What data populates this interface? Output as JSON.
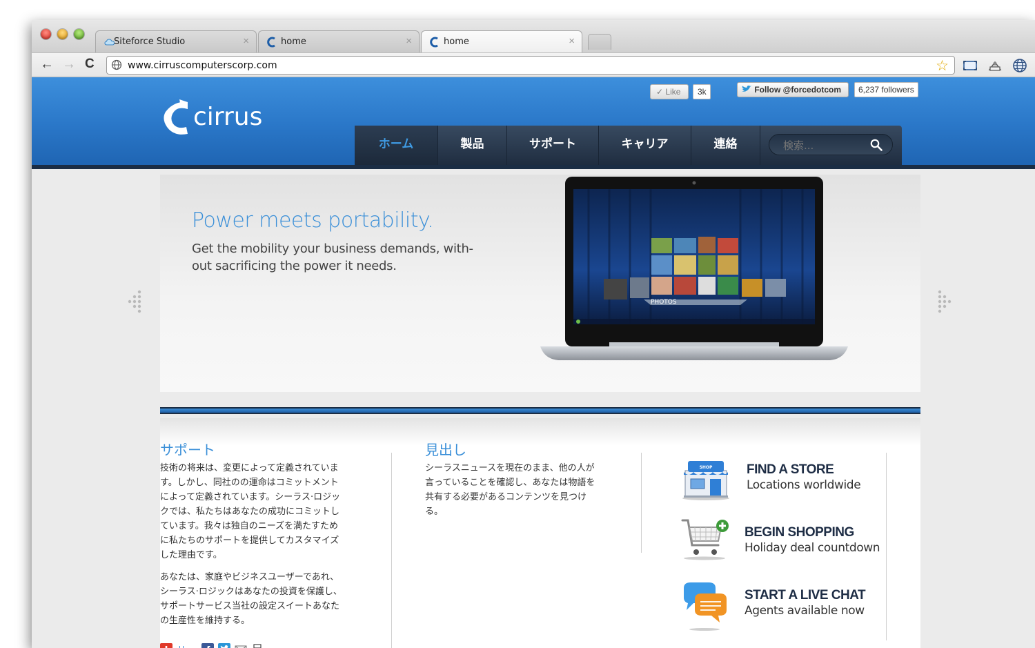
{
  "browser": {
    "tabs": [
      {
        "title": "Siteforce Studio",
        "close": "×"
      },
      {
        "title": "home",
        "close": "×"
      },
      {
        "title": "home",
        "close": "×",
        "active": true
      }
    ],
    "url": "www.cirruscomputerscorp.com",
    "star": "☆",
    "nav": {
      "back": "←",
      "forward": "→",
      "reload": "C"
    }
  },
  "header": {
    "logo_text": "cirrus",
    "like_label": "✓ Like",
    "like_count": "3k",
    "follow_label": "Follow @forcedotcom",
    "followers": "6,237 followers"
  },
  "nav": {
    "items": [
      "ホーム",
      "製品",
      "サポート",
      "キャリア",
      "連絡"
    ],
    "search_placeholder": "検索..."
  },
  "hero": {
    "title": "Power meets portability.",
    "subtitle_line1": "Get the mobility your business demands, with-",
    "subtitle_line2": "out sacrificing the power it needs.",
    "screen_label": "PHOTOS"
  },
  "support": {
    "title": "サポート",
    "p1_lines": [
      "技術の将来は、変更によって定義されていま",
      "す。しかし、同社のの運命はコミットメント",
      "によって定義されています。シーラス·ロジッ",
      "クでは、私たちはあなたの成功にコミットし",
      "ています。我々は独自のニーズを満たすため",
      "に私たちのサポートを提供してカスタマイズ",
      "した理由です。"
    ],
    "p2_lines": [
      "あなたは、家庭やビジネスユーザーであれ、",
      "シーラス·ロジックはあなたの投資を保護し、",
      "サポートサービス当社の設定スイートあなた",
      "の生産性を維持する。"
    ],
    "share_label": "共有"
  },
  "headline": {
    "title": "見出し",
    "lines": [
      "シーラスニュースを現在のまま、他の人が",
      "言っていることを確認し、あなたは物語を",
      "共有する必要があるコンテンツを見つけ",
      "る。"
    ]
  },
  "cta": [
    {
      "title": "FIND A STORE",
      "sub": "Locations worldwide",
      "icon_text": "SHOP"
    },
    {
      "title": "BEGIN SHOPPING",
      "sub": "Holiday deal countdown"
    },
    {
      "title": "START A LIVE CHAT",
      "sub": "Agents available now"
    }
  ],
  "colors": {
    "brand_blue": "#2a77c8",
    "nav_dark": "#1f2d40",
    "accent_text": "#3a8fd8"
  }
}
